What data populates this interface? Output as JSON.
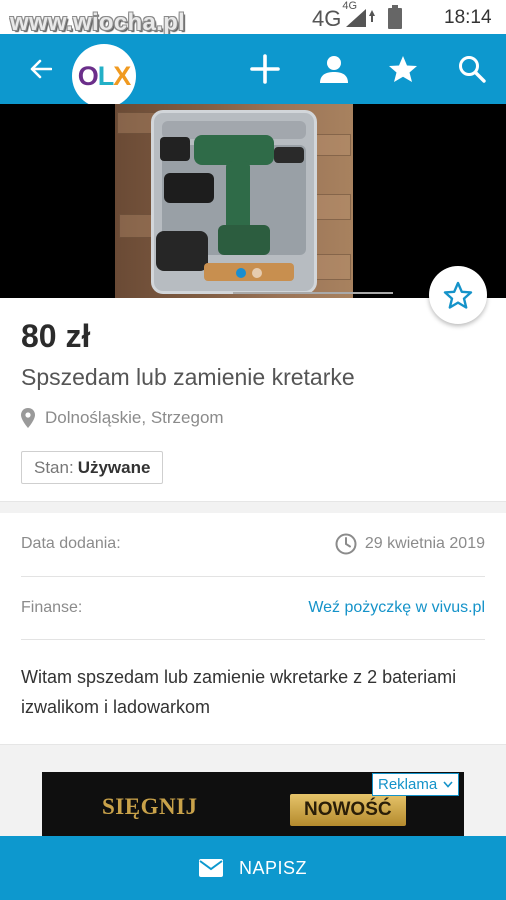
{
  "status_bar": {
    "watermark": "www.wiocha.pl",
    "network": "4G",
    "network_sup": "4G",
    "time": "18:14"
  },
  "app_bar": {
    "logo_o": "O",
    "logo_l": "L",
    "logo_x": "X",
    "icons": [
      "back-arrow-icon",
      "plus-icon",
      "person-icon",
      "star-icon",
      "search-icon"
    ],
    "color": "#0d98ce"
  },
  "gallery": {
    "image_count": 2,
    "active_index": 0
  },
  "listing": {
    "price": "80 zł",
    "title": "Spszedam lub zamienie kretarke",
    "location": "Dolnośląskie, Strzegom",
    "condition_label": "Stan:",
    "condition_value": "Używane"
  },
  "details": {
    "date_label": "Data dodania:",
    "date_value": "29 kwietnia 2019",
    "finance_label": "Finanse:",
    "finance_link": "Weź pożyczkę w vivus.pl"
  },
  "description": "Witam spszedam lub zamienie wkretarke z 2 bateriami izwalikom i ladowarkom",
  "ad": {
    "label": "Reklama",
    "headline": "SIĘGNIJ",
    "badge": "NOWOŚĆ"
  },
  "bottom_bar": {
    "label": "NAPISZ"
  }
}
